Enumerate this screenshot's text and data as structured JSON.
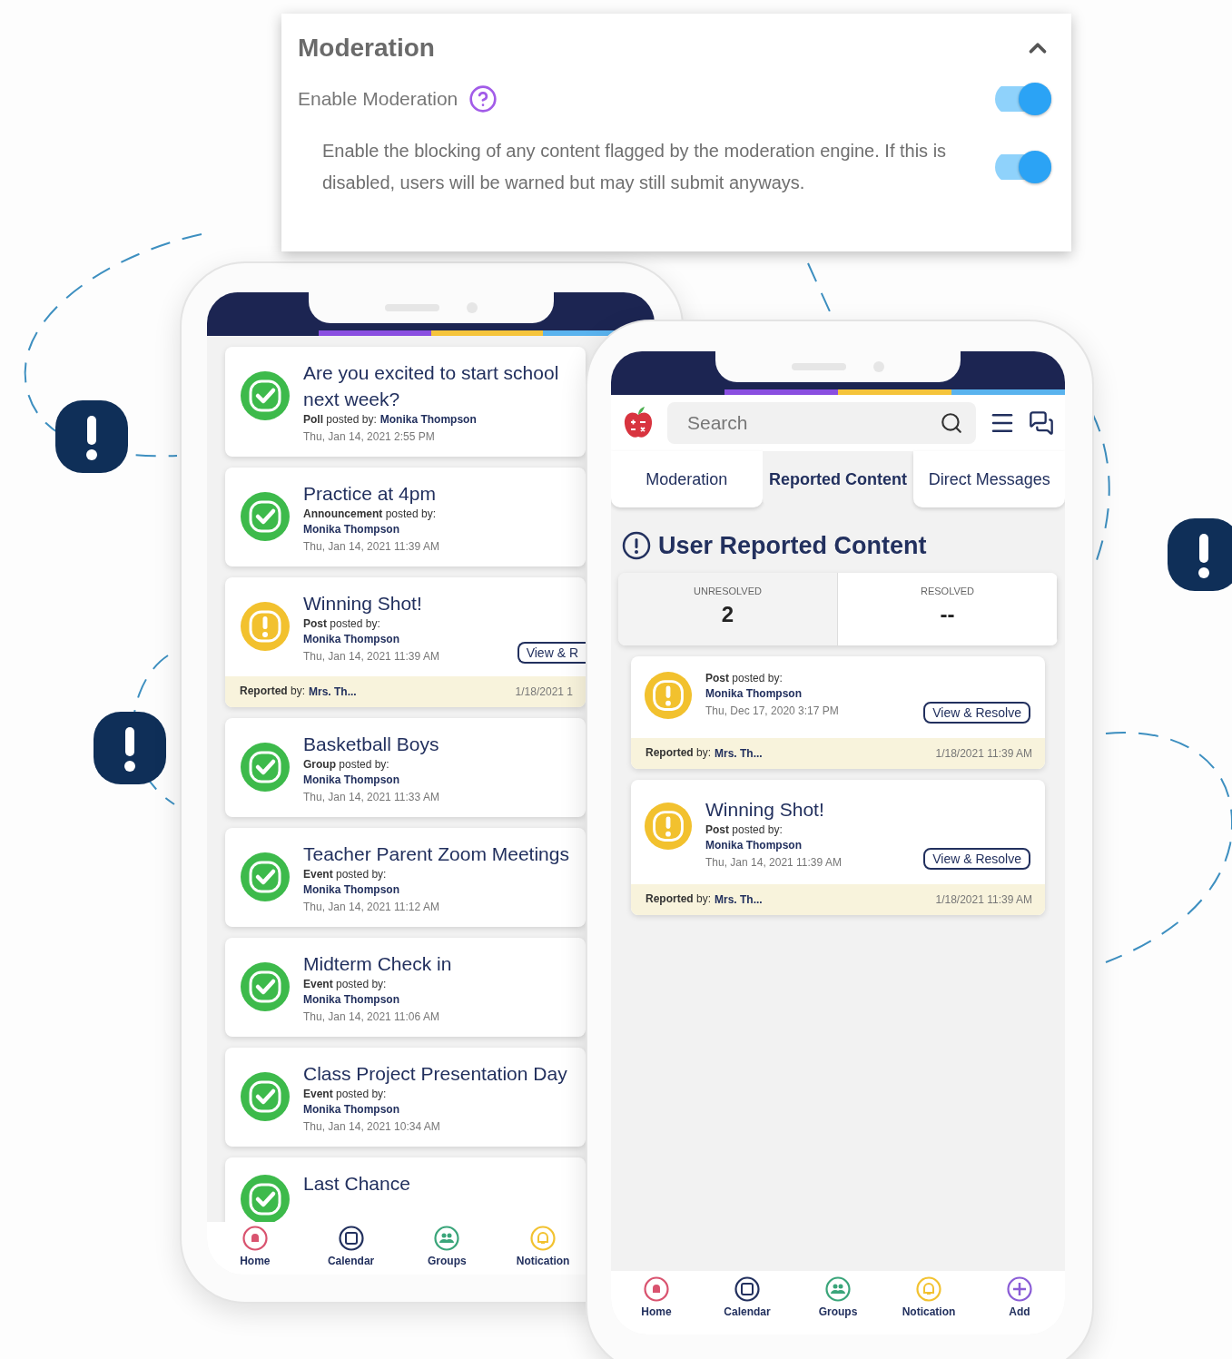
{
  "moderation_panel": {
    "title": "Moderation",
    "expanded": true,
    "enable_moderation": {
      "label": "Enable Moderation",
      "on": true
    },
    "blocking": {
      "text": "Enable the blocking of any content flagged by the moderation engine. If this is disabled, users will be warned but may still submit anyways.",
      "on": true
    }
  },
  "left_phone": {
    "feed": [
      {
        "title": "Are you excited to start school next week?",
        "byline": "**Poll** posted by:",
        "author": "Monika Thompson",
        "author_inline": true,
        "date": "Thu, Jan 14, 2021 2:55 PM",
        "kind": "approved"
      },
      {
        "title": "Practice at 4pm",
        "byline": "**Announcement** posted by:",
        "author": "Monika Thompson",
        "author_inline": false,
        "date": "Thu, Jan 14, 2021 11:39 AM",
        "kind": "approved"
      },
      {
        "title": "Winning Shot!",
        "byline": "**Post** posted by:",
        "author": "Monika Thompson",
        "author_inline": false,
        "date": "Thu, Jan 14, 2021 11:39 AM",
        "kind": "flagged",
        "button": "View & R",
        "report": {
          "line": "**Reported** by:",
          "name": "Mrs. Th...",
          "date": "1/18/2021 1"
        }
      },
      {
        "title": "Basketball Boys",
        "byline": "**Group** posted by:",
        "author": "Monika Thompson",
        "author_inline": false,
        "date": "Thu, Jan 14, 2021 11:33 AM",
        "kind": "approved"
      },
      {
        "title": "Teacher Parent Zoom Meetings",
        "byline": "**Event** posted by:",
        "author": "Monika Thompson",
        "author_inline": false,
        "date": "Thu, Jan 14, 2021 11:12 AM",
        "kind": "approved"
      },
      {
        "title": "Midterm Check in",
        "byline": "**Event** posted by:",
        "author": "Monika Thompson",
        "author_inline": false,
        "date": "Thu, Jan 14, 2021 11:06 AM",
        "kind": "approved"
      },
      {
        "title": "Class Project Presentation Day",
        "byline": "**Event** posted by:",
        "author": "Monika Thompson",
        "author_inline": false,
        "date": "Thu, Jan 14, 2021 10:34 AM",
        "kind": "approved"
      },
      {
        "title": "Last Chance",
        "kind": "approved"
      }
    ],
    "nav": [
      {
        "label": "Home",
        "kind": "home",
        "color": "#d9536f"
      },
      {
        "label": "Calendar",
        "kind": "calendar",
        "color": "#22305e"
      },
      {
        "label": "Groups",
        "kind": "groups",
        "color": "#3aa57a"
      },
      {
        "label": "Notication",
        "kind": "bell",
        "color": "#f2c230"
      }
    ]
  },
  "right_phone": {
    "search": {
      "placeholder": "Search"
    },
    "tabs": [
      {
        "label": "Moderation",
        "selected": false
      },
      {
        "label": "Reported Content",
        "selected": true
      },
      {
        "label": "Direct Messages",
        "selected": false
      }
    ],
    "heading": "User Reported Content",
    "stats": [
      {
        "label": "UNRESOLVED",
        "value": "2",
        "selected": true
      },
      {
        "label": "RESOLVED",
        "value": "--",
        "selected": false
      }
    ],
    "reports": [
      {
        "byline": "**Post** posted by:",
        "author": "Monika Thompson",
        "date": "Thu, Dec 17, 2020 3:17 PM",
        "button": "View & Resolve",
        "kind": "flagged",
        "report": {
          "line": "**Reported** by:",
          "name": "Mrs. Th...",
          "date": "1/18/2021 11:39 AM"
        }
      },
      {
        "title": "Winning Shot!",
        "byline": "**Post** posted by:",
        "author": "Monika Thompson",
        "date": "Thu, Jan 14, 2021 11:39 AM",
        "button": "View & Resolve",
        "kind": "flagged",
        "report": {
          "line": "**Reported** by:",
          "name": "Mrs. Th...",
          "date": "1/18/2021 11:39 AM"
        }
      }
    ],
    "nav": [
      {
        "label": "Home",
        "kind": "home",
        "color": "#d9536f"
      },
      {
        "label": "Calendar",
        "kind": "calendar",
        "color": "#22305e"
      },
      {
        "label": "Groups",
        "kind": "groups",
        "color": "#3aa57a"
      },
      {
        "label": "Notication",
        "kind": "bell",
        "color": "#f2c230"
      },
      {
        "label": "Add",
        "kind": "add",
        "color": "#8a5cd6"
      }
    ]
  }
}
